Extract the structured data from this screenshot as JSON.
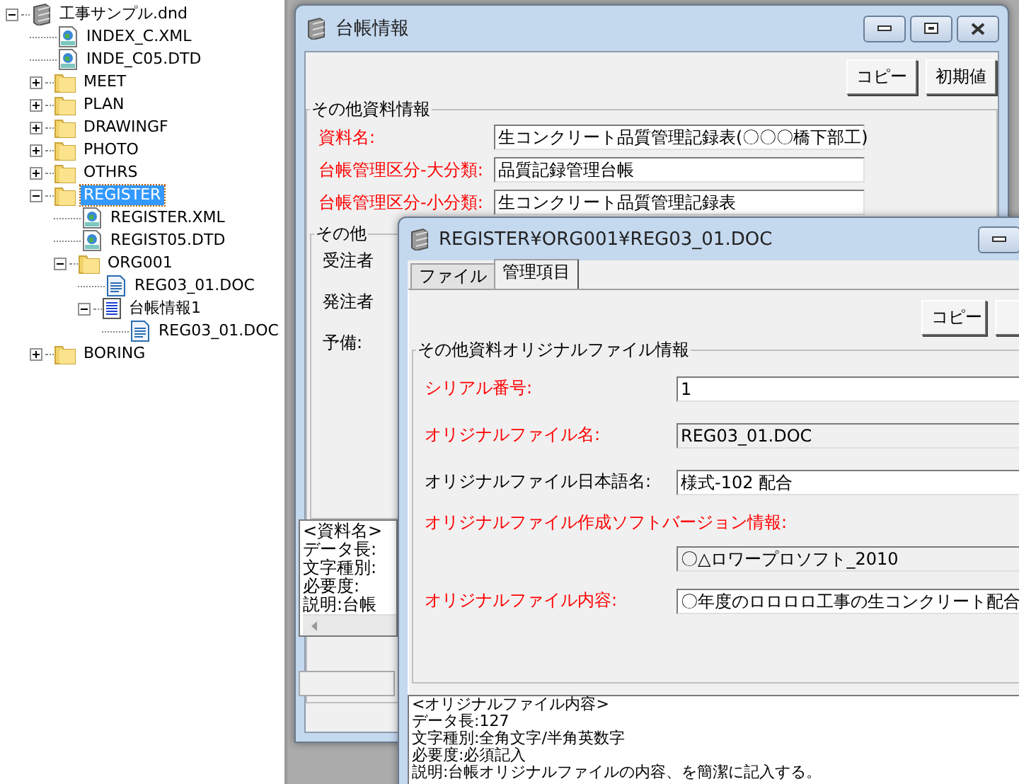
{
  "tree": {
    "label": "工事サンプル.dnd",
    "kind": "archive",
    "expanded": true,
    "selected": false,
    "children": [
      {
        "label": "INDEX_C.XML",
        "kind": "xml",
        "selected": false
      },
      {
        "label": "INDE_C05.DTD",
        "kind": "xml",
        "selected": false
      },
      {
        "label": "MEET",
        "kind": "folder",
        "expanded": false,
        "selected": false
      },
      {
        "label": "PLAN",
        "kind": "folder",
        "expanded": false,
        "selected": false
      },
      {
        "label": "DRAWINGF",
        "kind": "folder",
        "expanded": false,
        "selected": false
      },
      {
        "label": "PHOTO",
        "kind": "folder",
        "expanded": false,
        "selected": false
      },
      {
        "label": "OTHRS",
        "kind": "folder",
        "expanded": false,
        "selected": false
      },
      {
        "label": "REGISTER",
        "kind": "folder",
        "expanded": true,
        "selected": true,
        "children": [
          {
            "label": "REGISTER.XML",
            "kind": "xml",
            "selected": false
          },
          {
            "label": "REGIST05.DTD",
            "kind": "xml",
            "selected": false
          },
          {
            "label": "ORG001",
            "kind": "folder",
            "expanded": true,
            "selected": false,
            "children": [
              {
                "label": "REG03_01.DOC",
                "kind": "doc",
                "selected": false
              },
              {
                "label": "台帳情報1",
                "kind": "info",
                "expanded": true,
                "selected": false,
                "children": [
                  {
                    "label": "REG03_01.DOC",
                    "kind": "doc",
                    "selected": false
                  }
                ]
              }
            ]
          }
        ]
      },
      {
        "label": "BORING",
        "kind": "folder",
        "expanded": false,
        "selected": false
      }
    ]
  },
  "ledger_window": {
    "title": "台帳情報",
    "buttons": [
      "コピー",
      "初期値"
    ],
    "group_title": "その他資料情報",
    "fields": [
      {
        "label": "資料名:",
        "required": true,
        "value": "生コンクリート品質管理記録表(〇〇〇橋下部工)"
      },
      {
        "label": "台帳管理区分-大分類:",
        "required": true,
        "value": "品質記録管理台帳"
      },
      {
        "label": "台帳管理区分-小分類:",
        "required": true,
        "value": "生コンクリート品質管理記録表"
      }
    ],
    "subgroup_title": "その他",
    "subgroup_labels": [
      "受注者",
      "発注者",
      "予備:"
    ],
    "help_lines": [
      "<資料名>",
      "データ長:",
      "文字種別:",
      "必要度:",
      "説明:台帳"
    ]
  },
  "file_window": {
    "title": "REGISTER¥ORG001¥REG03_01.DOC",
    "tabs": [
      {
        "label": "ファイル",
        "selected": false
      },
      {
        "label": "管理項目",
        "selected": true
      }
    ],
    "buttons": [
      "コピー"
    ],
    "group_title": "その他資料オリジナルファイル情報",
    "fields": [
      {
        "label": "シリアル番号:",
        "required": true,
        "readonly": false,
        "kind": "inline",
        "value": "1"
      },
      {
        "label": "オリジナルファイル名:",
        "required": true,
        "readonly": true,
        "kind": "inline",
        "value": "REG03_01.DOC"
      },
      {
        "label": "オリジナルファイル日本語名:",
        "required": false,
        "readonly": false,
        "kind": "inline",
        "value": "様式-102 配合"
      },
      {
        "label": "オリジナルファイル作成ソフトバージョン情報:",
        "required": true,
        "readonly": true,
        "kind": "stacked",
        "value": "〇△ロワープロソフト_2010"
      },
      {
        "label": "オリジナルファイル内容:",
        "required": true,
        "readonly": false,
        "kind": "inline",
        "value": "〇年度のロロロロ工事の生コンクリート配合"
      }
    ],
    "help_lines": [
      "<オリジナルファイル内容>",
      "データ長:127",
      "文字種別:全角文字/半角英数字",
      "必要度:必須記入",
      "説明:台帳オリジナルファイルの内容、を簡潔に記入する。"
    ]
  }
}
